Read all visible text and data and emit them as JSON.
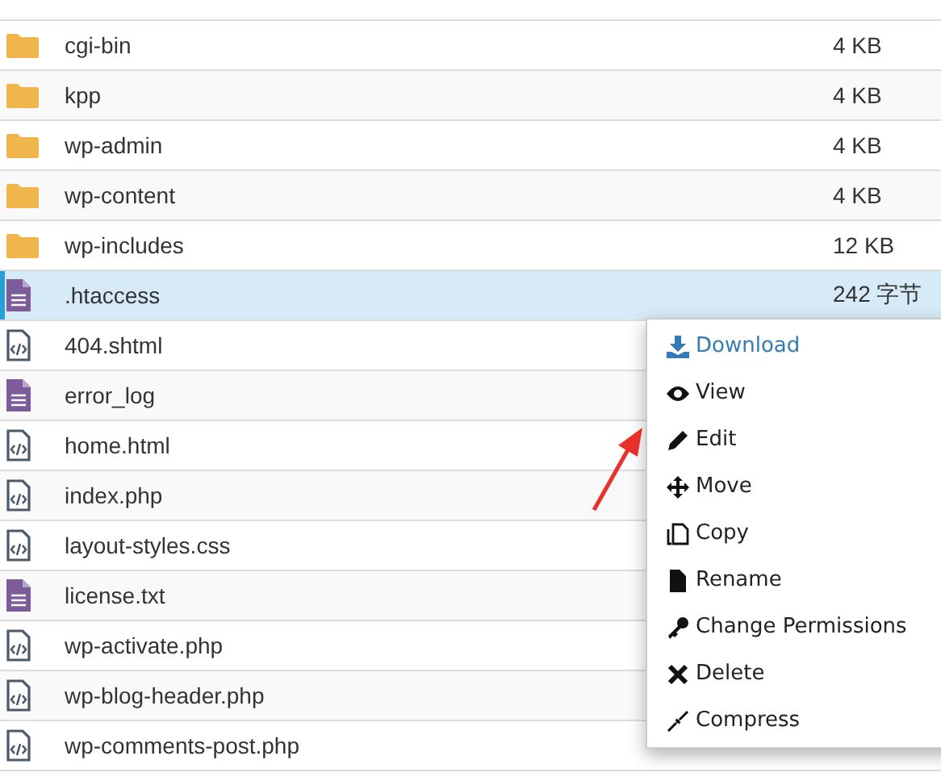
{
  "files": [
    {
      "name": "cgi-bin",
      "kind": "folder",
      "size": "4 KB",
      "selected": false
    },
    {
      "name": "kpp",
      "kind": "folder",
      "size": "4 KB",
      "selected": false
    },
    {
      "name": "wp-admin",
      "kind": "folder",
      "size": "4 KB",
      "selected": false
    },
    {
      "name": "wp-content",
      "kind": "folder",
      "size": "4 KB",
      "selected": false
    },
    {
      "name": "wp-includes",
      "kind": "folder",
      "size": "12 KB",
      "selected": false
    },
    {
      "name": ".htaccess",
      "kind": "text",
      "size": "242 字节",
      "selected": true
    },
    {
      "name": "404.shtml",
      "kind": "code",
      "selected": false
    },
    {
      "name": "error_log",
      "kind": "text",
      "selected": false
    },
    {
      "name": "home.html",
      "kind": "code",
      "selected": false
    },
    {
      "name": "index.php",
      "kind": "code",
      "selected": false
    },
    {
      "name": "layout-styles.css",
      "kind": "code",
      "selected": false
    },
    {
      "name": "license.txt",
      "kind": "text",
      "selected": false
    },
    {
      "name": "wp-activate.php",
      "kind": "code",
      "selected": false
    },
    {
      "name": "wp-blog-header.php",
      "kind": "code",
      "selected": false
    },
    {
      "name": "wp-comments-post.php",
      "kind": "code",
      "selected": false
    }
  ],
  "context_menu": [
    {
      "label": "Download",
      "kind": "download",
      "highlighted": true
    },
    {
      "label": "View",
      "kind": "view",
      "highlighted": false
    },
    {
      "label": "Edit",
      "kind": "edit",
      "highlighted": false
    },
    {
      "label": "Move",
      "kind": "move",
      "highlighted": false
    },
    {
      "label": "Copy",
      "kind": "copy",
      "highlighted": false
    },
    {
      "label": "Rename",
      "kind": "rename",
      "highlighted": false
    },
    {
      "label": "Change Permissions",
      "kind": "key",
      "highlighted": false
    },
    {
      "label": "Delete",
      "kind": "delete",
      "highlighted": false
    },
    {
      "label": "Compress",
      "kind": "compress",
      "highlighted": false
    }
  ],
  "annotation": {
    "kind": "arrow"
  }
}
